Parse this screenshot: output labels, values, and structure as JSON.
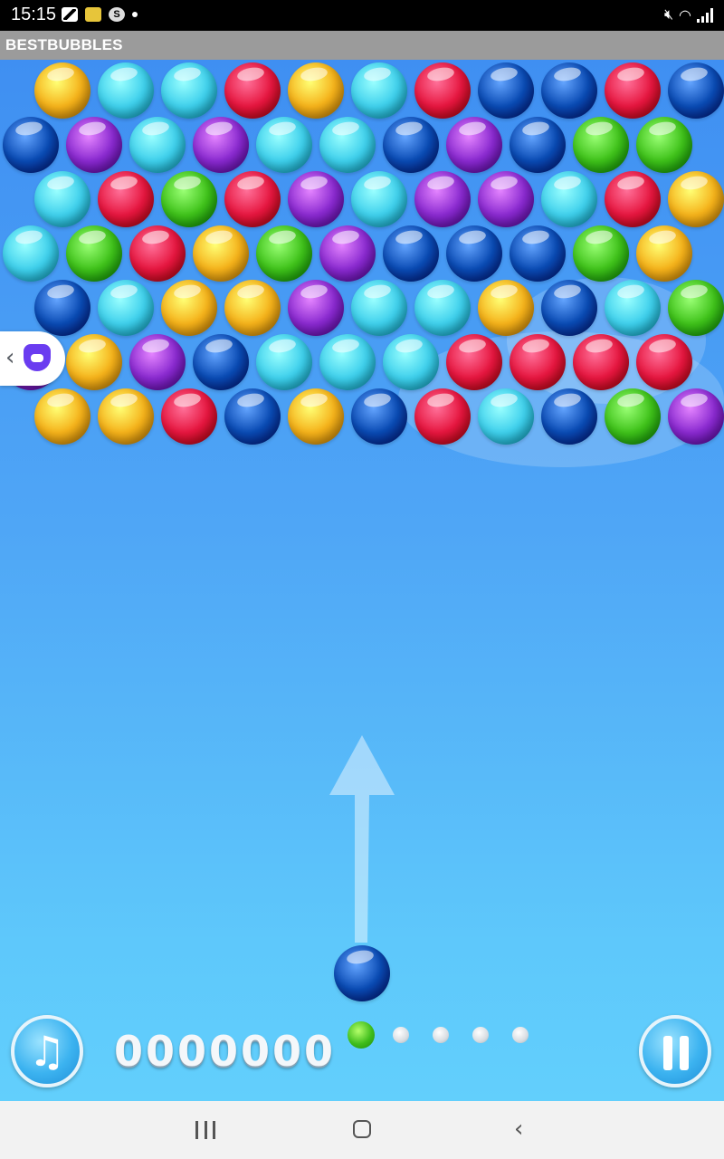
{
  "status_bar": {
    "time": "15:15"
  },
  "app": {
    "title": "BESTBUBBLES"
  },
  "colors": {
    "orange": "#f5b21a",
    "cyan": "#3fd0ec",
    "red": "#e6163f",
    "darkblue": "#0a4bb4",
    "purple": "#8a2ad0",
    "green": "#3fc21a"
  },
  "bubble_grid": {
    "rows": [
      [
        "orange",
        "cyan",
        "cyan",
        "red",
        "orange",
        "cyan",
        "red",
        "darkblue",
        "darkblue",
        "red",
        "darkblue"
      ],
      [
        "darkblue",
        "purple",
        "cyan",
        "purple",
        "cyan",
        "cyan",
        "darkblue",
        "purple",
        "darkblue",
        "green",
        "green"
      ],
      [
        "cyan",
        "red",
        "green",
        "red",
        "purple",
        "cyan",
        "purple",
        "purple",
        "cyan",
        "red",
        "orange"
      ],
      [
        "cyan",
        "green",
        "red",
        "orange",
        "green",
        "purple",
        "darkblue",
        "darkblue",
        "darkblue",
        "green",
        "orange"
      ],
      [
        "darkblue",
        "cyan",
        "orange",
        "orange",
        "purple",
        "cyan",
        "cyan",
        "orange",
        "darkblue",
        "cyan",
        "green"
      ],
      [
        "purple",
        "orange",
        "purple",
        "darkblue",
        "cyan",
        "cyan",
        "cyan",
        "red",
        "red",
        "red",
        "red"
      ],
      [
        "orange",
        "orange",
        "red",
        "darkblue",
        "orange",
        "darkblue",
        "red",
        "cyan",
        "darkblue",
        "green",
        "purple"
      ]
    ]
  },
  "shooter": {
    "color": "darkblue"
  },
  "score": "0000000",
  "progress": {
    "total": 5,
    "current": 1,
    "current_color": "green"
  },
  "icons": {
    "music": "music-note-icon",
    "pause": "pause-icon",
    "side_tab": "cat-assistant-icon"
  }
}
